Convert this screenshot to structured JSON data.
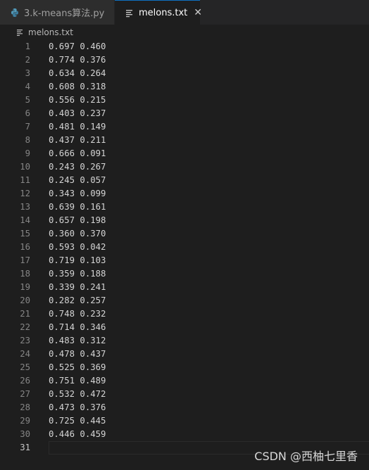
{
  "tabs": [
    {
      "label": "3.k-means算法.py",
      "icon": "python-icon",
      "active": false
    },
    {
      "label": "melons.txt",
      "icon": "text-file-icon",
      "active": true,
      "close": "✕"
    }
  ],
  "breadcrumb": {
    "label": "melons.txt",
    "icon": "text-file-icon"
  },
  "editor": {
    "lines": [
      "0.697 0.460",
      "0.774 0.376",
      "0.634 0.264",
      "0.608 0.318",
      "0.556 0.215",
      "0.403 0.237",
      "0.481 0.149",
      "0.437 0.211",
      "0.666 0.091",
      "0.243 0.267",
      "0.245 0.057",
      "0.343 0.099",
      "0.639 0.161",
      "0.657 0.198",
      "0.360 0.370",
      "0.593 0.042",
      "0.719 0.103",
      "0.359 0.188",
      "0.339 0.241",
      "0.282 0.257",
      "0.748 0.232",
      "0.714 0.346",
      "0.483 0.312",
      "0.478 0.437",
      "0.525 0.369",
      "0.751 0.489",
      "0.532 0.472",
      "0.473 0.376",
      "0.725 0.445",
      "0.446 0.459",
      ""
    ],
    "current_line": 31
  },
  "watermark": "CSDN @西柚七里香",
  "colors": {
    "background": "#1e1e1e",
    "tab_active_border": "#0e70c0",
    "text": "#d4d4d4",
    "line_number": "#858585"
  }
}
